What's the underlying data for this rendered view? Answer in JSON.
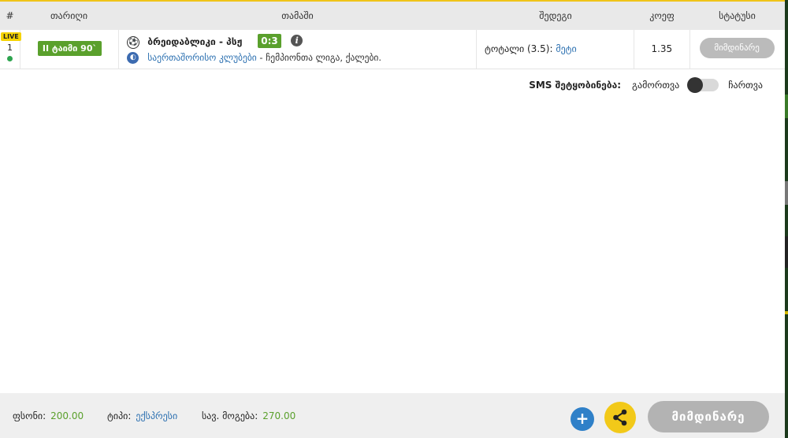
{
  "header": {
    "col_num": "#",
    "col_date": "თარიღი",
    "col_match": "თამაში",
    "col_bet": "შედეგი",
    "col_odd": "კოეფ",
    "col_status": "სტატუსი"
  },
  "row": {
    "live_badge": "LIVE",
    "number": "1",
    "time": "II ტაიმი 90`",
    "sport_icon": "soccer-ball-icon",
    "match_title": "ბრეიდაბლიკი - პსჟ",
    "score": "0:3",
    "info_symbol": "i",
    "league_link": "საერთაშორისო კლუბები",
    "league_rest": " - ჩემპიონთა ლიგა, ქალები.",
    "bet_label": "ტოტალი (3.5): ",
    "bet_pick": "მეტი",
    "odd": "1.35",
    "status": "მიმდინარე"
  },
  "sms": {
    "label": "SMS შეტყობინება:",
    "off": "გამორთვა",
    "on": "ჩართვა",
    "enabled": false
  },
  "footer": {
    "stake_label": "ფსონი:",
    "stake_value": "200.00",
    "type_label": "ტიპი:",
    "type_value": "ექსპრესი",
    "win_label": "სავ. მოგება:",
    "win_value": "270.00",
    "plus_symbol": "+",
    "status_button": "მიმდინარე"
  },
  "colors": {
    "accent_yellow": "#f2c919",
    "green": "#5aa02c",
    "blue": "#2a6fb0",
    "status_gray": "#b3b3b3"
  }
}
